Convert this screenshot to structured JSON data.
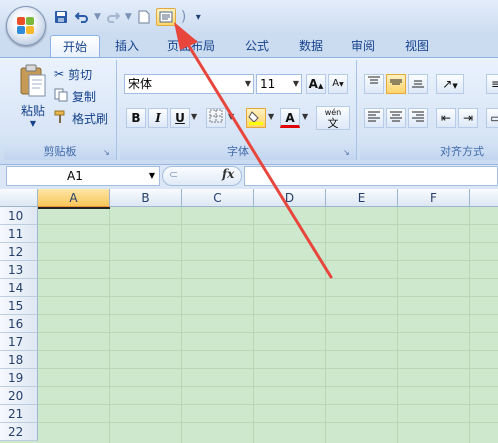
{
  "quick_access": {
    "save_icon": "save-icon",
    "undo_icon": "undo-icon",
    "redo_icon": "redo-icon",
    "new_icon": "new-document-icon",
    "print_preview_icon": "print-preview-icon",
    "customize_icon": "customize-qat-icon"
  },
  "tabs": [
    {
      "label": "开始",
      "active": true
    },
    {
      "label": "插入"
    },
    {
      "label": "页面布局"
    },
    {
      "label": "公式"
    },
    {
      "label": "数据"
    },
    {
      "label": "审阅"
    },
    {
      "label": "视图"
    }
  ],
  "clipboard": {
    "paste_label": "粘贴",
    "cut_label": "剪切",
    "copy_label": "复制",
    "format_painter_label": "格式刷",
    "group_label": "剪贴板"
  },
  "font": {
    "font_name": "宋体",
    "font_size": "11",
    "bold": "B",
    "italic": "I",
    "underline": "U",
    "font_color_glyph": "A",
    "grow_glyph": "A",
    "shrink_glyph": "A",
    "phonetic_glyph": "文",
    "phonetic_top": "wén",
    "group_label": "字体"
  },
  "alignment": {
    "group_label": "对齐方式"
  },
  "formula_bar": {
    "name_box": "A1",
    "fx_label": "fx",
    "formula": ""
  },
  "columns": [
    "A",
    "B",
    "C",
    "D",
    "E",
    "F"
  ],
  "rows": [
    "10",
    "11",
    "12",
    "13",
    "14",
    "15",
    "16",
    "17",
    "18",
    "19",
    "20",
    "21",
    "22"
  ],
  "colors": {
    "sheet_background": "#cde8cc",
    "annotation_arrow": "#e8453c",
    "selected_header": "#f9c55a"
  }
}
